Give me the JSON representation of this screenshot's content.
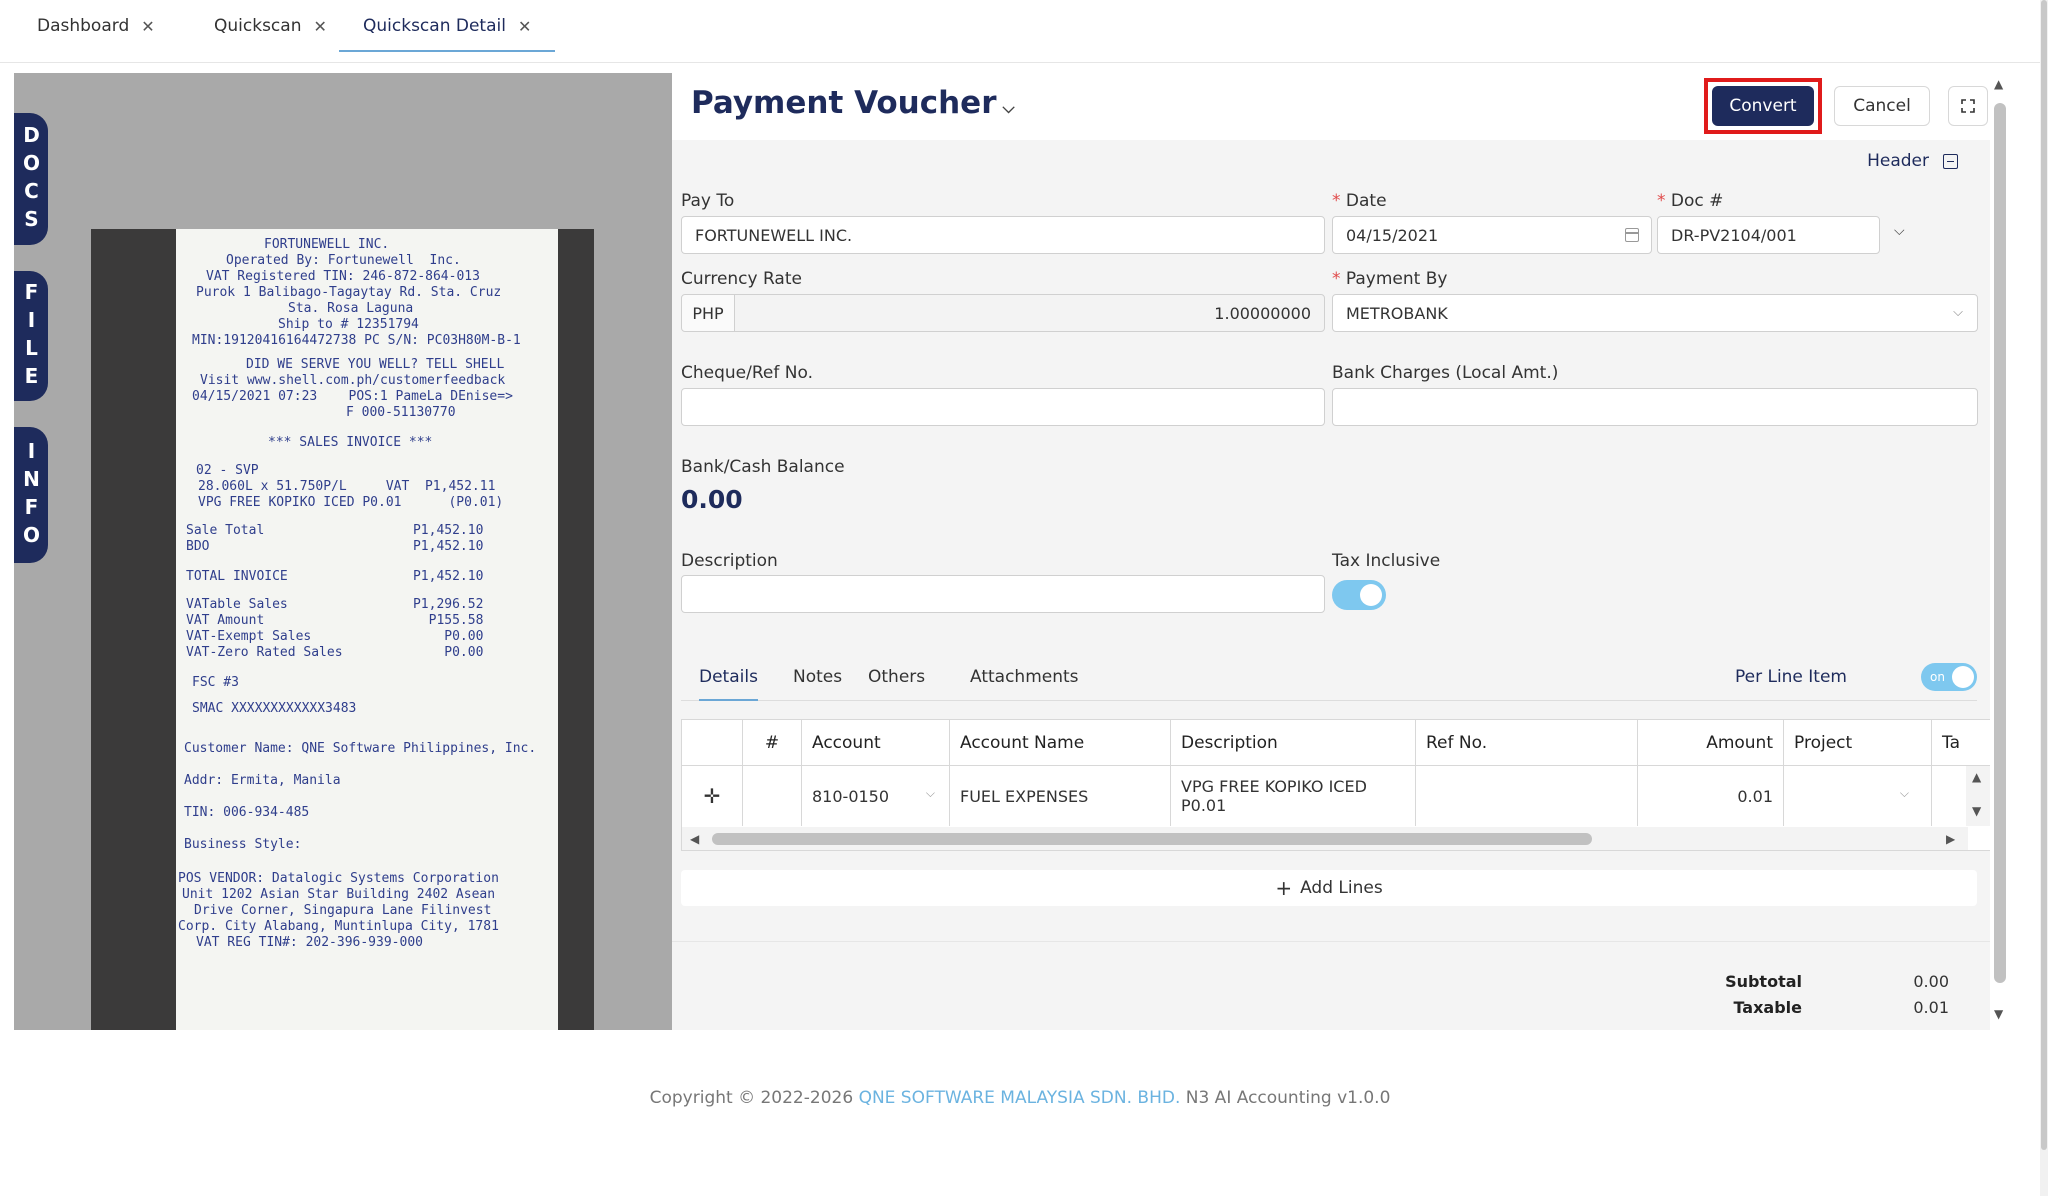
{
  "tabs": [
    {
      "label": "Dashboard"
    },
    {
      "label": "Quickscan"
    },
    {
      "label": "Quickscan Detail"
    }
  ],
  "side_tabs": {
    "docs": "DOCS",
    "file": "FILE",
    "info": "INFO"
  },
  "receipt_lines": [
    "FORTUNEWELL INC.",
    "Operated By: Fortunewell  Inc.",
    "VAT Registered TIN: 246-872-864-013",
    "Purok 1 Balibago-Tagaytay Rd. Sta. Cruz",
    "Sta. Rosa Laguna",
    "Ship to # 12351794",
    "MIN:19120416164472738 PC S/N: PC03H80M-B-1",
    "DID WE SERVE YOU WELL? TELL SHELL",
    "Visit www.shell.com.ph/customerfeedback",
    "04/15/2021 07:23    POS:1 PameLa DEnise=>",
    "F 000-51130770",
    "*** SALES INVOICE ***",
    "02 - SVP",
    "28.060L x 51.750P/L     VAT  P1,452.11",
    "VPG FREE KOPIKO ICED P0.01      (P0.01)",
    "Sale Total                   P1,452.10",
    "BDO                          P1,452.10",
    "TOTAL INVOICE                P1,452.10",
    "VATable Sales                P1,296.52",
    "VAT Amount                     P155.58",
    "VAT-Exempt Sales                 P0.00",
    "VAT-Zero Rated Sales             P0.00",
    "FSC #3",
    "SMAC XXXXXXXXXXXX3483",
    "Customer Name: QNE Software Philippines, Inc.",
    "Addr: Ermita, Manila",
    "TIN: 006-934-485",
    "Business Style:",
    "POS VENDOR: Datalogic Systems Corporation",
    "Unit 1202 Asian Star Building 2402 Asean",
    "Drive Corner, Singapura Lane Filinvest",
    "Corp. City Alabang, Muntinlupa City, 1781",
    "VAT REG TIN#: 202-396-939-000"
  ],
  "voucher": {
    "title": "Payment Voucher",
    "convert_label": "Convert",
    "cancel_label": "Cancel",
    "header_label": "Header",
    "pay_to_label": "Pay To",
    "pay_to_value": "FORTUNEWELL INC.",
    "date_label": "Date",
    "date_value": "04/15/2021",
    "doc_label": "Doc #",
    "doc_value": "DR-PV2104/001",
    "currency_rate_label": "Currency Rate",
    "currency_code": "PHP",
    "currency_rate_value": "1.00000000",
    "payment_by_label": "Payment By",
    "payment_by_value": "METROBANK",
    "cheque_label": "Cheque/Ref No.",
    "cheque_value": "",
    "bank_charges_label": "Bank Charges (Local Amt.)",
    "bank_charges_value": "",
    "balance_label": "Bank/Cash Balance",
    "balance_value": "0.00",
    "description_label": "Description",
    "description_value": "",
    "tax_inclusive_label": "Tax Inclusive",
    "tax_inclusive_on": true
  },
  "subtabs": [
    {
      "label": "Details"
    },
    {
      "label": "Notes"
    },
    {
      "label": "Others"
    },
    {
      "label": "Attachments"
    }
  ],
  "per_line_item_label": "Per Line Item",
  "per_line_item_toggle": "on",
  "grid": {
    "headers": [
      "#",
      "Account",
      "Account Name",
      "Description",
      "Ref No.",
      "Amount",
      "Project",
      "Ta"
    ],
    "rows": [
      {
        "num": "",
        "account": "810-0150",
        "account_name": "FUEL EXPENSES",
        "description": "VPG FREE KOPIKO ICED P0.01",
        "ref_no": "",
        "amount": "0.01",
        "project": ""
      }
    ]
  },
  "add_lines_label": "Add Lines",
  "totals": {
    "subtotal_label": "Subtotal",
    "subtotal_value": "0.00",
    "taxable_label": "Taxable",
    "taxable_value": "0.01"
  },
  "footer": {
    "prefix": "Copyright © 2022-2026",
    "company": "QNE SOFTWARE MALAYSIA SDN. BHD.",
    "suffix": "N3 AI Accounting v1.0.0"
  },
  "colors": {
    "brand_navy": "#1e2b5c",
    "accent_blue": "#6ba7d6",
    "toggle_blue": "#7ec8ef",
    "highlight_red": "#e01b1b"
  }
}
